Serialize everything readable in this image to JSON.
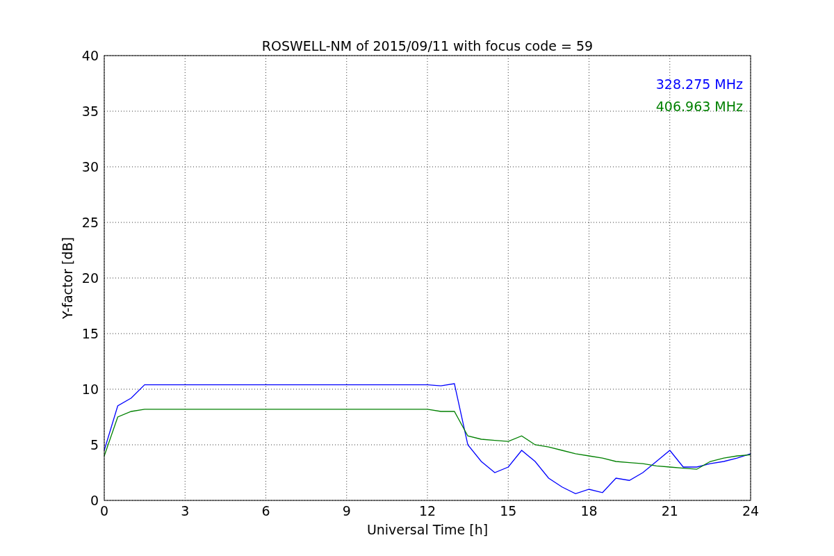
{
  "chart_data": {
    "type": "line",
    "title": "ROSWELL-NM of 2015/09/11 with focus code = 59",
    "xlabel": "Universal Time [h]",
    "ylabel": "Y-factor [dB]",
    "x": [
      0,
      0.5,
      1,
      1.5,
      2,
      2.5,
      3,
      3.5,
      4,
      4.5,
      5,
      5.5,
      6,
      6.5,
      7,
      7.5,
      8,
      8.5,
      9,
      9.5,
      10,
      10.5,
      11,
      11.5,
      12,
      12.5,
      13,
      13.5,
      14,
      14.5,
      15,
      15.5,
      16,
      16.5,
      17,
      17.5,
      18,
      18.5,
      19,
      19.5,
      20,
      20.5,
      21,
      21.5,
      22,
      22.5,
      23,
      23.5,
      24
    ],
    "series": [
      {
        "name": "328.275 MHz",
        "color": "#0000ff",
        "values": [
          4.5,
          8.5,
          9.2,
          10.4,
          10.4,
          10.4,
          10.4,
          10.4,
          10.4,
          10.4,
          10.4,
          10.4,
          10.4,
          10.4,
          10.4,
          10.4,
          10.4,
          10.4,
          10.4,
          10.4,
          10.4,
          10.4,
          10.4,
          10.4,
          10.4,
          10.3,
          10.5,
          5,
          3.5,
          2.5,
          3,
          4.5,
          3.5,
          2,
          1.2,
          0.6,
          1,
          0.7,
          2,
          1.8,
          2.5,
          3.5,
          4.5,
          3,
          3,
          3.3,
          3.5,
          3.8,
          4.2
        ]
      },
      {
        "name": "406.963 MHz",
        "color": "#008000",
        "values": [
          4,
          7.5,
          8,
          8.2,
          8.2,
          8.2,
          8.2,
          8.2,
          8.2,
          8.2,
          8.2,
          8.2,
          8.2,
          8.2,
          8.2,
          8.2,
          8.2,
          8.2,
          8.2,
          8.2,
          8.2,
          8.2,
          8.2,
          8.2,
          8.2,
          8,
          8,
          5.8,
          5.5,
          5.4,
          5.3,
          5.8,
          5,
          4.8,
          4.5,
          4.2,
          4,
          3.8,
          3.5,
          3.4,
          3.3,
          3.1,
          3,
          2.9,
          2.8,
          3.5,
          3.8,
          4,
          4.1
        ]
      }
    ],
    "xlim": [
      0,
      24
    ],
    "ylim": [
      0,
      40
    ],
    "xticks": [
      0,
      3,
      6,
      9,
      12,
      15,
      18,
      21,
      24
    ],
    "yticks": [
      0,
      5,
      10,
      15,
      20,
      25,
      30,
      35,
      40
    ],
    "grid": true
  }
}
